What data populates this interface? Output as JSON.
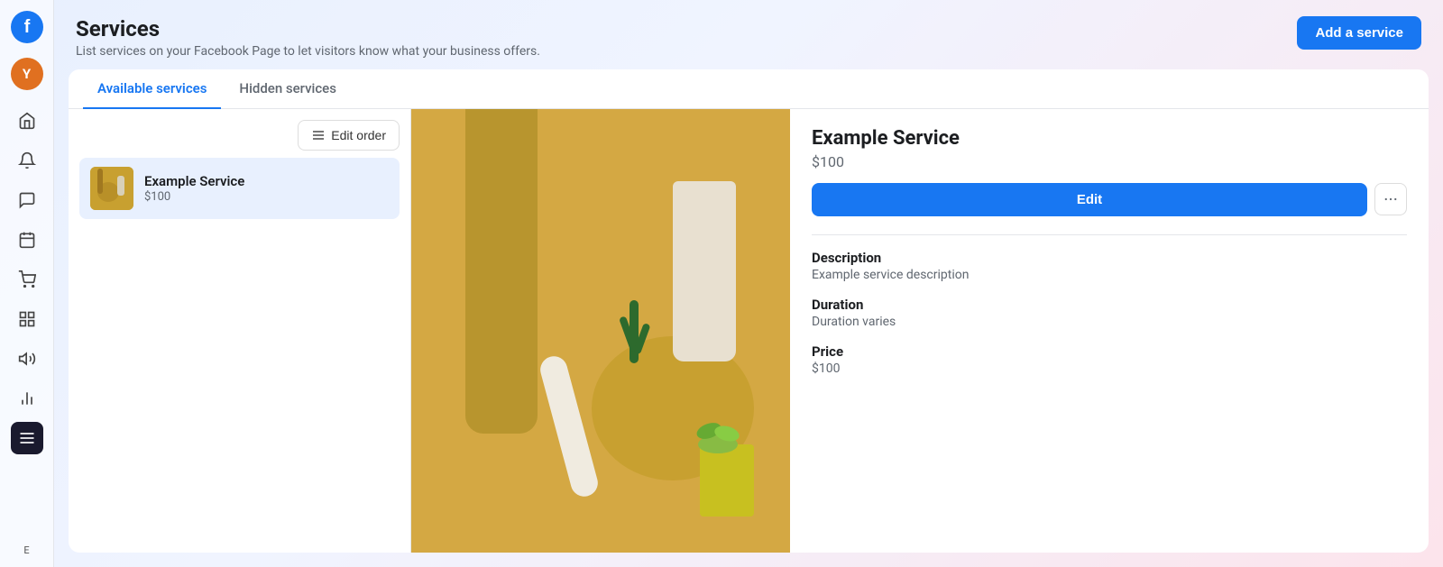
{
  "sidebar": {
    "logo_letter": "f",
    "avatar_letter": "Y",
    "icons": [
      {
        "name": "home-icon",
        "symbol": "⌂"
      },
      {
        "name": "notification-icon",
        "symbol": "🔔"
      },
      {
        "name": "chat-icon",
        "symbol": "💬"
      },
      {
        "name": "calendar-icon",
        "symbol": "▦"
      },
      {
        "name": "shop-icon",
        "symbol": "🛒"
      },
      {
        "name": "grid-icon",
        "symbol": "⊞"
      },
      {
        "name": "megaphone-icon",
        "symbol": "📢"
      },
      {
        "name": "chart-icon",
        "symbol": "📊"
      },
      {
        "name": "menu-icon",
        "symbol": "☰"
      }
    ],
    "bottom_label": "E"
  },
  "header": {
    "title": "Services",
    "subtitle": "List services on your Facebook Page to let visitors know what your business offers.",
    "add_button_label": "Add a service"
  },
  "tabs": [
    {
      "id": "available",
      "label": "Available services",
      "active": true
    },
    {
      "id": "hidden",
      "label": "Hidden services",
      "active": false
    }
  ],
  "edit_order_label": "Edit order",
  "service_list": [
    {
      "name": "Example Service",
      "price": "$100",
      "selected": true
    }
  ],
  "service_detail": {
    "name": "Example Service",
    "price": "$100",
    "edit_label": "Edit",
    "more_label": "···",
    "description_label": "Description",
    "description_value": "Example service description",
    "duration_label": "Duration",
    "duration_value": "Duration varies",
    "price_label": "Price",
    "price_value": "$100"
  }
}
